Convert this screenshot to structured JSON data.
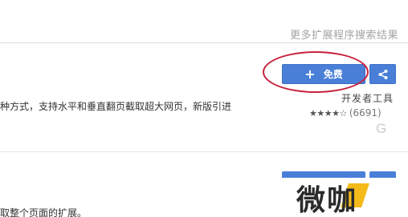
{
  "header": {
    "more_results": "更多扩展程序搜索结果"
  },
  "extension": {
    "free_button_label": "免费",
    "description": "种方式，支持水平和垂直翻页截取超大网页，新版引进",
    "category": "开发者工具",
    "stars": "★★★★☆",
    "rating_count": "(6691)",
    "icons": {
      "plus": "plus-icon",
      "share": "share-icon",
      "g": "g-icon"
    }
  },
  "second_extension": {
    "description": "取整个页面的扩展。"
  },
  "watermark": {
    "text": "微咖"
  },
  "colors": {
    "button_blue": "#4a7fd8",
    "annotation_red": "#c8203e",
    "watermark_yellow": "#f2b300"
  }
}
